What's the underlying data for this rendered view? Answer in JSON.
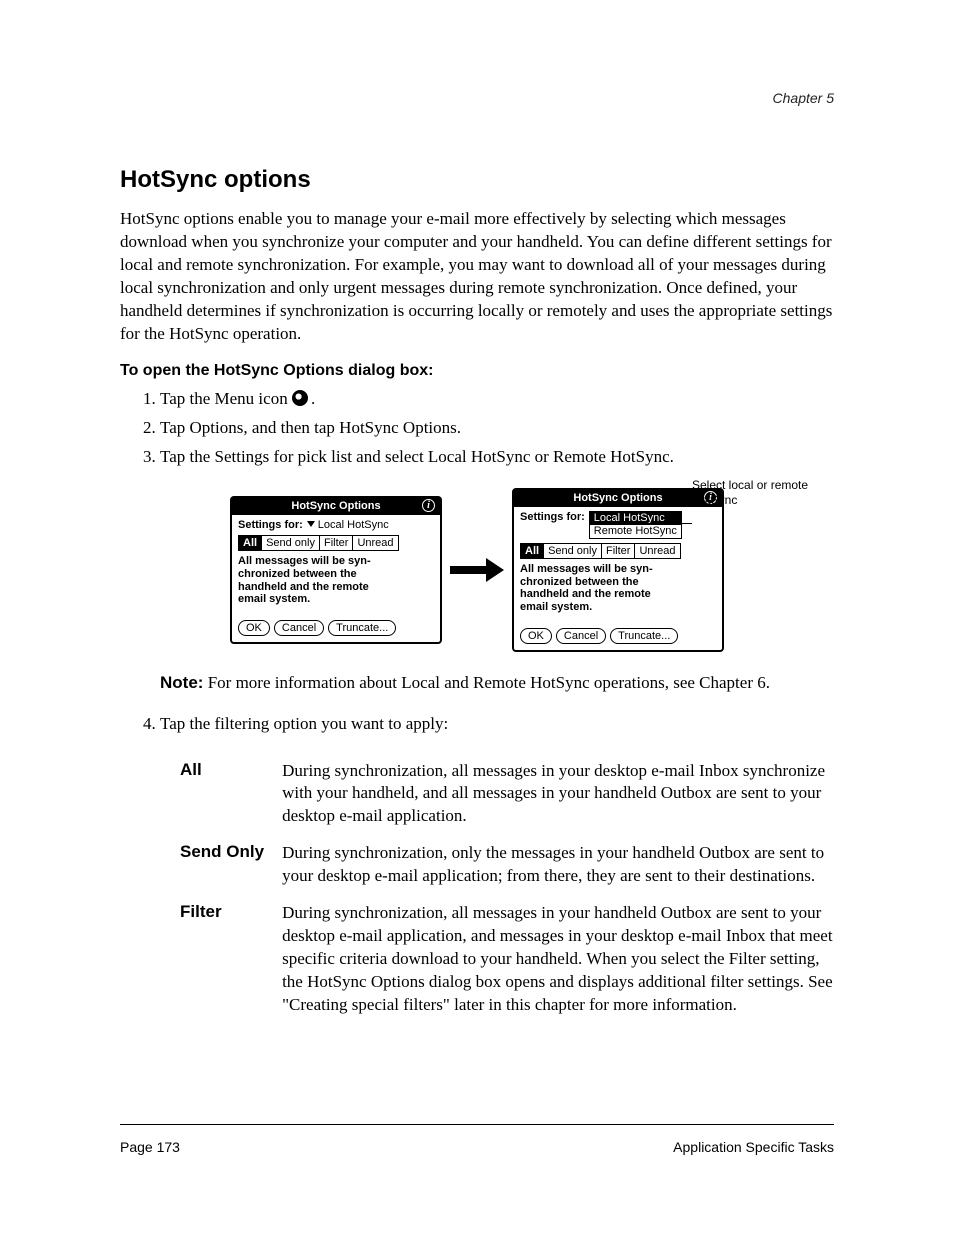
{
  "header": {
    "chapter": "Chapter 5"
  },
  "section": {
    "title": "HotSync options",
    "p1": "HotSync options enable you to manage your e-mail more effectively by selecting which messages download when you synchronize your computer and your handheld. You can define different settings for local and remote synchronization. For example, you may want to download all of your messages during local synchronization and only urgent messages during remote synchronization. Once defined, your handheld determines if synchronization is occurring locally or remotely and uses the appropriate settings for the HotSync operation.",
    "subhead": "To open the HotSync Options dialog box:",
    "steps": [
      "Tap the Menu icon",
      "Tap Options, and then tap HotSync Options.",
      "Tap the Settings for pick list and select Local HotSync or Remote HotSync."
    ],
    "menu_icon_suffix": ".",
    "note_label": "Note:",
    "note_text": "For more information about Local and Remote HotSync operations, see Chapter 6."
  },
  "dialog": {
    "title": "HotSync Options",
    "settings_label": "Settings for:",
    "selected": "Local HotSync",
    "dropdown": [
      "Local HotSync",
      "Remote HotSync"
    ],
    "tabs": [
      "All",
      "Send only",
      "Filter",
      "Unread"
    ],
    "desc": "All messages will be syn-\nchronized between the\nhandheld and the remote\nemail system.",
    "buttons": {
      "ok": "OK",
      "cancel": "Cancel",
      "truncate": "Truncate..."
    }
  },
  "callout": "Select local or remote HotSync",
  "after_figure": {
    "step4": "Tap the filtering option you want to apply:",
    "options": [
      {
        "term": "All",
        "def": "During synchronization, all messages in your desktop e-mail Inbox synchronize with your handheld, and all messages in your handheld Outbox are sent to your desktop e-mail application."
      },
      {
        "term": "Send Only",
        "def": "During synchronization, only the messages in your handheld Outbox are sent to your desktop e-mail application; from there, they are sent to their destinations."
      },
      {
        "term": "Filter",
        "def": "During synchronization, all messages in your handheld Outbox are sent to your desktop e-mail application, and messages in your desktop e-mail Inbox that meet specific criteria download to your handheld. When you select the Filter setting, the HotSync Options dialog box opens and displays additional filter settings. See \"Creating special filters\" later in this chapter for more information."
      }
    ]
  },
  "footer": {
    "page": "Page 173",
    "doc": "Application Specific Tasks"
  }
}
